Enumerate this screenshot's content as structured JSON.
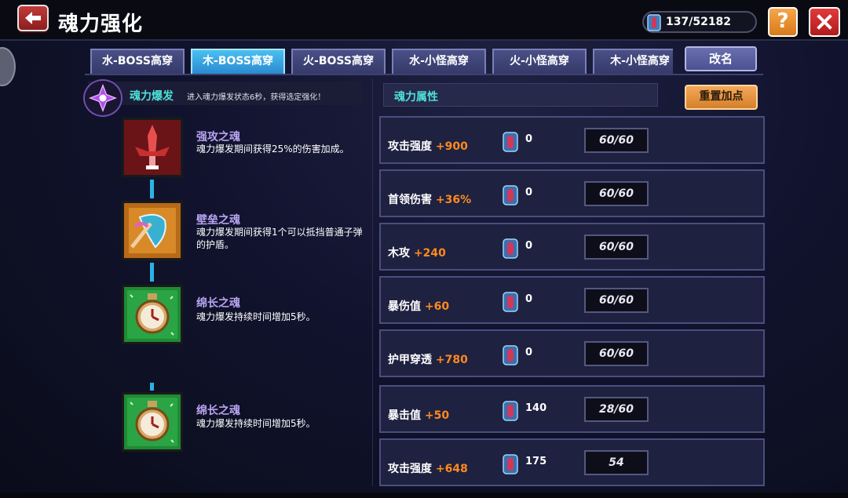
{
  "header": {
    "title": "魂力强化",
    "currency": "137/52182",
    "help_label": "?"
  },
  "tabs": [
    {
      "label": "水-BOSS高穿",
      "active": false
    },
    {
      "label": "木-BOSS高穿",
      "active": true
    },
    {
      "label": "火-BOSS高穿",
      "active": false
    },
    {
      "label": "水-小怪高穿",
      "active": false
    },
    {
      "label": "火-小怪高穿",
      "active": false
    },
    {
      "label": "木-小怪高穿",
      "active": false
    }
  ],
  "rename_label": "改名",
  "burst": {
    "title": "魂力爆发",
    "description": "进入魂力爆发状态6秒，获得选定强化！"
  },
  "skills": [
    {
      "name": "强攻之魂",
      "description": "魂力爆发期间获得25%的伤害加成。",
      "icon": "sword-icon"
    },
    {
      "name": "壁垒之魂",
      "description": "魂力爆发期间获得1个可以抵挡普通子弹的护盾。",
      "icon": "shield-icon"
    },
    {
      "name": "绵长之魂",
      "description": "魂力爆发持续时间增加5秒。",
      "icon": "clock-icon"
    },
    {
      "name": "绵长之魂",
      "description": "魂力爆发持续时间增加5秒。",
      "icon": "clock-icon"
    }
  ],
  "attributes_header": "魂力属性",
  "reset_label": "重置加点",
  "attributes": [
    {
      "name": "攻击强度",
      "bonus": "+900",
      "cost": "0",
      "level": "60/60"
    },
    {
      "name": "首领伤害",
      "bonus": "+36%",
      "cost": "0",
      "level": "60/60"
    },
    {
      "name": "木攻",
      "bonus": "+240",
      "cost": "0",
      "level": "60/60"
    },
    {
      "name": "暴伤值",
      "bonus": "+60",
      "cost": "0",
      "level": "60/60"
    },
    {
      "name": "护甲穿透",
      "bonus": "+780",
      "cost": "0",
      "level": "60/60"
    },
    {
      "name": "暴击值",
      "bonus": "+50",
      "cost": "140",
      "level": "28/60"
    },
    {
      "name": "攻击强度",
      "bonus": "+648",
      "cost": "175",
      "level": "54"
    }
  ],
  "colors": {
    "accent_cyan": "#4ee0d8",
    "bonus_orange": "#ff8a1e",
    "skill_name_purple": "#b8a4f0",
    "active_tab": "#2a8ad0",
    "close_red": "#e23a3a",
    "help_orange": "#f7a64a"
  }
}
